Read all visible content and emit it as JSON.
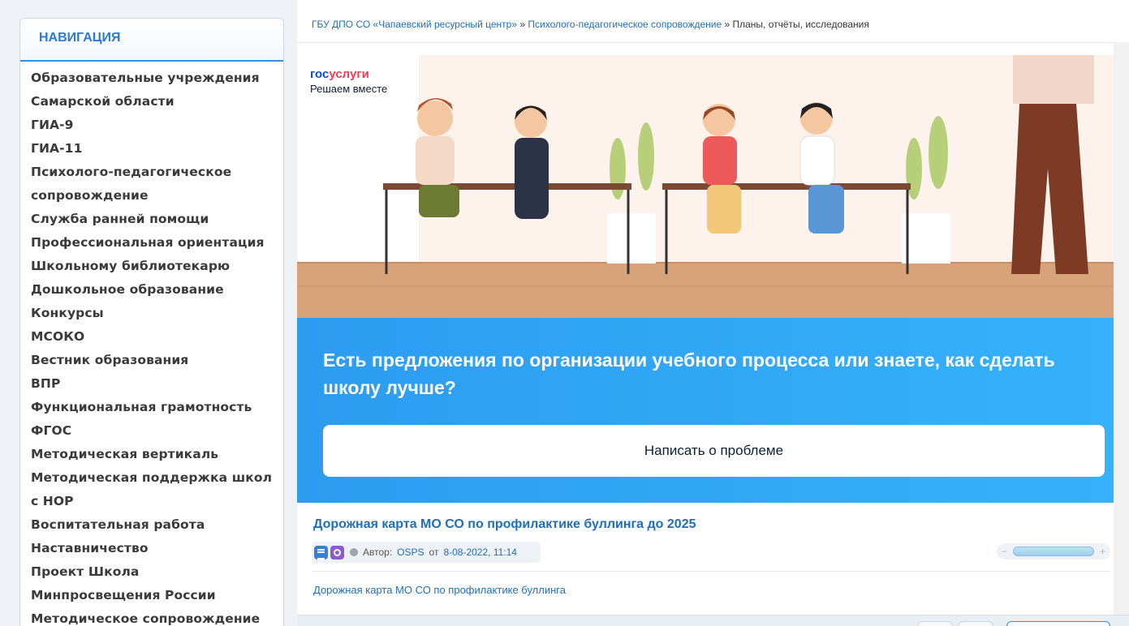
{
  "sidebar": {
    "title": "НАВИГАЦИЯ",
    "items": [
      "Образовательные учреждения",
      "Самарской области",
      "ГИА-9",
      "ГИА-11",
      "Психолого-педагогическое",
      "сопровождение",
      "Служба ранней помощи",
      "Профессиональная ориентация",
      "Школьному библиотекарю",
      "Дошкольное образование",
      "Конкурсы",
      "МСОКО",
      "Вестник образования",
      "ВПР",
      "Функциональная грамотность",
      "ФГОС",
      "Методическая вертикаль",
      "Методическая поддержка школ",
      "с НОР",
      "Воспитательная работа",
      "Наставничество",
      "Проект Школа",
      "Минпросвещения России",
      "Методическое сопровождение"
    ]
  },
  "breadcrumb": {
    "item1": "ГБУ ДПО СО «Чапаевский ресурсный центр»",
    "sep": " » ",
    "item2": "Психолого-педагогическое сопровождение",
    "item3": "Планы, отчёты, исследования"
  },
  "banner": {
    "logo_part1": "гос",
    "logo_part2": "услуги",
    "logo_sub": "Решаем вместе",
    "question": "Есть предложения по организации учебного процесса или знаете, как сделать школу лучше?",
    "button": "Написать о проблеме"
  },
  "article": {
    "title": "Дорожная карта МО СО по профилактике буллинга до 2025",
    "author_prefix": "Автор:",
    "author": "OSPS",
    "date_prefix": "от",
    "date": "8-08-2022, 11:14",
    "link": "Дорожная карта МО СО по профилактике буллинга",
    "rating_minus": "−",
    "rating_plus": "+"
  },
  "colors": {
    "accent": "#2a7ccc",
    "banner_blue": "#2d9cf0",
    "link": "#1f6fb8"
  }
}
